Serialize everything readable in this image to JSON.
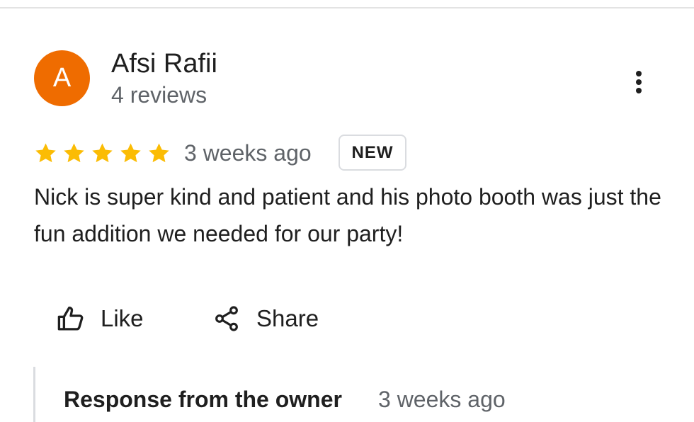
{
  "colors": {
    "avatar_bg": "#ef6c00",
    "star": "#fbbc04",
    "secondary_text": "#5f6368",
    "primary_text": "#1f1f1f"
  },
  "review": {
    "author": {
      "initial": "A",
      "name": "Afsi Rafii",
      "reviews_count": "4 reviews"
    },
    "more_icon": "more-vertical-icon",
    "rating": 5,
    "rating_max": 5,
    "time": "3 weeks ago",
    "badge": "NEW",
    "text": "Nick is super kind and patient and his photo booth was just the fun addition we needed for our party!"
  },
  "actions": {
    "like": {
      "label": "Like",
      "icon": "thumbs-up-icon"
    },
    "share": {
      "label": "Share",
      "icon": "share-icon"
    }
  },
  "owner_response": {
    "title": "Response from the owner",
    "time": "3 weeks ago"
  }
}
